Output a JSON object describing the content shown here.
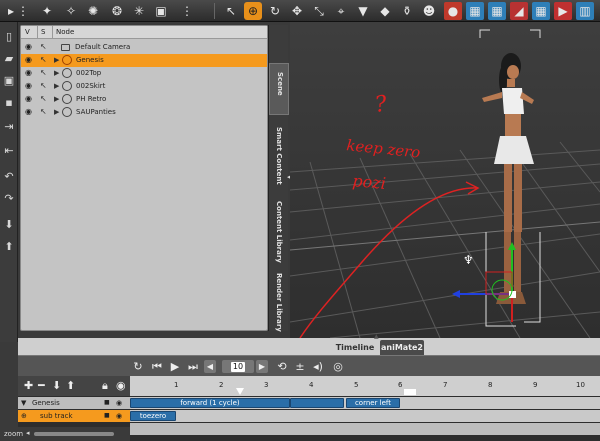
{
  "scene_panel": {
    "headers": {
      "visible": "V",
      "selectable": "S",
      "node": "Node"
    },
    "nodes": [
      {
        "label": "Default Camera",
        "type": "camera",
        "selected": false
      },
      {
        "label": "Genesis",
        "type": "figure",
        "selected": true
      },
      {
        "label": "002Top",
        "type": "clothing",
        "selected": false
      },
      {
        "label": "002Skirt",
        "type": "clothing",
        "selected": false
      },
      {
        "label": "PH Retro",
        "type": "hair",
        "selected": false
      },
      {
        "label": "SAUPanties",
        "type": "clothing",
        "selected": false
      }
    ]
  },
  "side_tabs": [
    "Scene",
    "Smart Content",
    "Content Library",
    "Render Library"
  ],
  "viewport": {
    "annotation_question": "?",
    "annotation_line1": "keep zero",
    "annotation_line2": "pozi"
  },
  "timeline": {
    "tabs": [
      "Timeline",
      "aniMate2"
    ],
    "frame_value": "10",
    "ruler_ticks": [
      "1",
      "2",
      "3",
      "4",
      "5",
      "6",
      "7",
      "8",
      "9",
      "10"
    ],
    "tracks": [
      {
        "label": "Genesis",
        "clips": [
          {
            "text": "forward (1 cycle)"
          },
          {
            "text": "corner left"
          }
        ]
      },
      {
        "label": "sub track",
        "clips": [
          {
            "text": "toezero"
          }
        ]
      }
    ],
    "zoom_label": "zoom"
  },
  "colors": {
    "accent": "#f59a1e",
    "clip": "#2a6ea8",
    "annotation": "#e02020"
  }
}
